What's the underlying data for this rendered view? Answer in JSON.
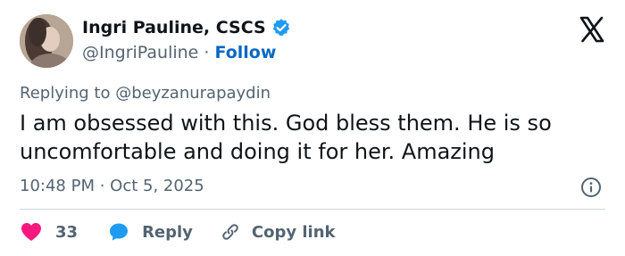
{
  "author": {
    "display_name": "Ingri Pauline, CSCS",
    "handle": "@IngriPauline",
    "separator": " · ",
    "follow_label": "Follow",
    "verified_color": "#1d9bf0"
  },
  "reply_context": "Replying to @beyzanurapaydin",
  "tweet": {
    "text": "I am obsessed with this. God bless them. He is so uncomfortable and doing it for her. Amazing",
    "timestamp": "10:48 PM · Oct 5, 2025"
  },
  "actions": {
    "like_count": "33",
    "reply_label": "Reply",
    "copy_link_label": "Copy link"
  },
  "icons": {
    "avatar": "avatar",
    "verified": "verified-badge-icon",
    "brand": "x-logo-icon",
    "info": "info-icon",
    "like": "heart-icon",
    "reply": "speech-bubble-icon",
    "copy_link": "link-icon"
  },
  "colors": {
    "heart": "#f91880",
    "reply_bubble": "#1d9bf0",
    "follow_link": "#0a68c4",
    "secondary_text": "#536471"
  }
}
